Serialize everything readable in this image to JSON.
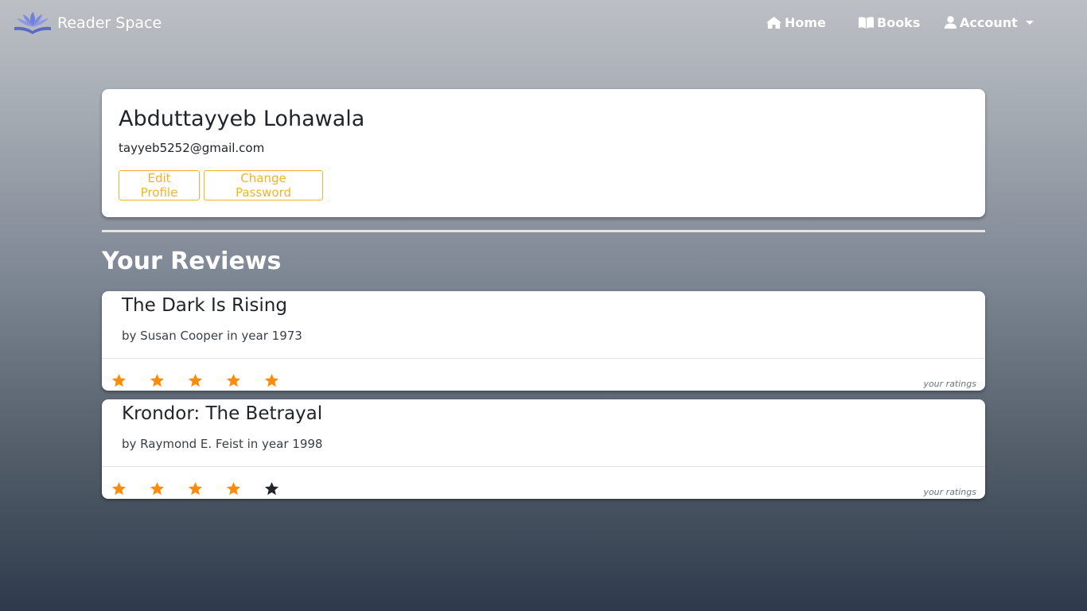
{
  "nav": {
    "brand": "Reader Space",
    "home": "Home",
    "books": "Books",
    "account": "Account"
  },
  "profile": {
    "name": "Abduttayyeb Lohawala",
    "email": "tayyeb5252@gmail.com",
    "edit_label": "Edit Profile",
    "change_password_label": "Change Password"
  },
  "reviews_heading": "Your Reviews",
  "reviews": [
    {
      "title": "The Dark Is Rising",
      "meta": "by Susan Cooper in year 1973",
      "rating": 5,
      "max_rating": 5,
      "ratings_label": "your ratings"
    },
    {
      "title": "Krondor: The Betrayal",
      "meta": "by Raymond E. Feist in year 1998",
      "rating": 4,
      "max_rating": 5,
      "ratings_label": "your ratings"
    }
  ],
  "colors": {
    "accent": "#f0b429",
    "star_filled": "#ff8c00",
    "star_empty": "#212529"
  }
}
